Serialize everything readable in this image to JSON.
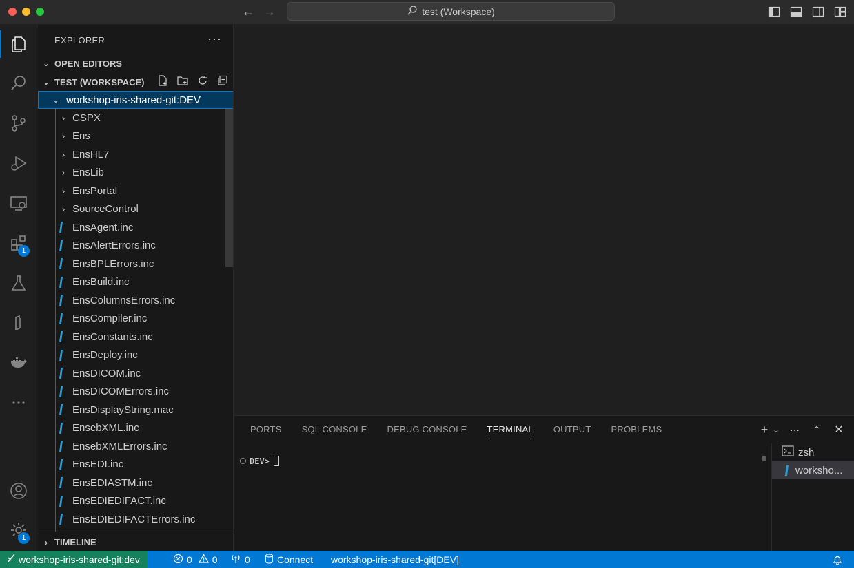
{
  "titlebar": {
    "search_text": "test (Workspace)"
  },
  "activity_bar": {
    "items": [
      {
        "name": "explorer",
        "icon": "files-icon"
      },
      {
        "name": "search",
        "icon": "search-icon"
      },
      {
        "name": "source-control",
        "icon": "source-control-icon"
      },
      {
        "name": "run-debug",
        "icon": "run-debug-icon"
      },
      {
        "name": "remote-explorer",
        "icon": "remote-explorer-icon"
      },
      {
        "name": "extensions",
        "icon": "extensions-icon",
        "badge": "1"
      },
      {
        "name": "testing",
        "icon": "flask-icon"
      },
      {
        "name": "intersystems",
        "icon": "intersystems-icon"
      },
      {
        "name": "docker",
        "icon": "docker-icon"
      },
      {
        "name": "more",
        "icon": "ellipsis-icon"
      }
    ],
    "accounts_icon": "account-icon",
    "manage_badge": "1"
  },
  "sidebar": {
    "title": "EXPLORER",
    "open_editors": "OPEN EDITORS",
    "workspace": "TEST (WORKSPACE)",
    "timeline": "TIMELINE",
    "root_folder": "workshop-iris-shared-git:DEV",
    "folders": [
      "CSPX",
      "Ens",
      "EnsHL7",
      "EnsLib",
      "EnsPortal",
      "SourceControl"
    ],
    "files": [
      "EnsAgent.inc",
      "EnsAlertErrors.inc",
      "EnsBPLErrors.inc",
      "EnsBuild.inc",
      "EnsColumnsErrors.inc",
      "EnsCompiler.inc",
      "EnsConstants.inc",
      "EnsDeploy.inc",
      "EnsDICOM.inc",
      "EnsDICOMErrors.inc",
      "EnsDisplayString.mac",
      "EnsebXML.inc",
      "EnsebXMLErrors.inc",
      "EnsEDI.inc",
      "EnsEDIASTM.inc",
      "EnsEDIEDIFACT.inc",
      "EnsEDIEDIFACTErrors.inc"
    ]
  },
  "panel": {
    "tabs": [
      "PORTS",
      "SQL CONSOLE",
      "DEBUG CONSOLE",
      "TERMINAL",
      "OUTPUT",
      "PROBLEMS"
    ],
    "active_tab": "TERMINAL",
    "terminal_prompt": "DEV>",
    "terminals": [
      "zsh",
      "worksho..."
    ]
  },
  "statusbar": {
    "remote": "workshop-iris-shared-git:dev",
    "errors": "0",
    "warnings": "0",
    "ports": "0",
    "connect": "Connect",
    "server": "workshop-iris-shared-git[DEV]"
  }
}
